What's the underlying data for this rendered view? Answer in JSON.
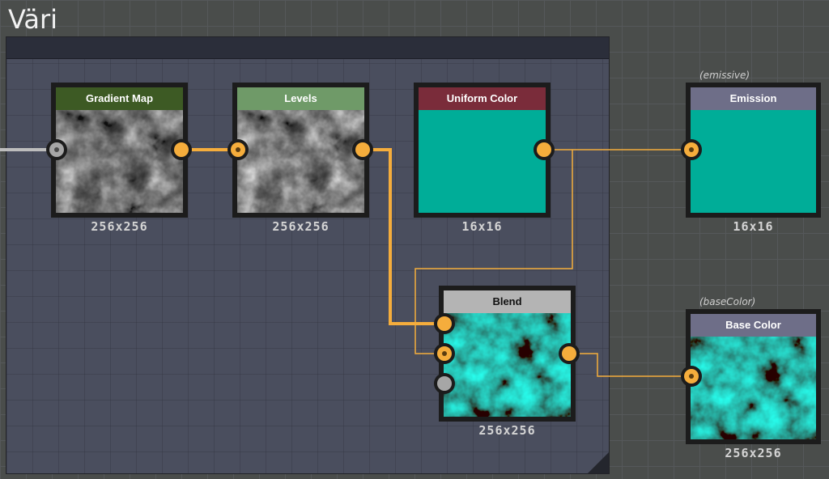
{
  "frame": {
    "title": "Väri"
  },
  "colors": {
    "link": "#f5ad3c",
    "port": "#f5ad3c",
    "port_unlinked": "#a6a6a6",
    "teal": "#00ad98"
  },
  "nodes": {
    "gradient_map": {
      "title": "Gradient Map",
      "size": "256x256",
      "header_color": "#3d5a24",
      "thumb": "grayscale-noise"
    },
    "levels": {
      "title": "Levels",
      "size": "256x256",
      "header_color": "#6f9a68",
      "thumb": "grayscale-noise"
    },
    "uniform_color": {
      "title": "Uniform Color",
      "size": "16x16",
      "header_color": "#7a2c3a",
      "thumb": "solid-teal"
    },
    "blend": {
      "title": "Blend",
      "size": "256x256",
      "header_color": "#b4b4b4",
      "thumb": "teal-noise"
    },
    "emission": {
      "title": "Emission",
      "size": "16x16",
      "header_color": "#6e6e88",
      "tag": "(emissive)",
      "thumb": "solid-teal"
    },
    "base_color": {
      "title": "Base Color",
      "size": "256x256",
      "header_color": "#6e6e88",
      "tag": "(baseColor)",
      "thumb": "teal-noise"
    }
  }
}
